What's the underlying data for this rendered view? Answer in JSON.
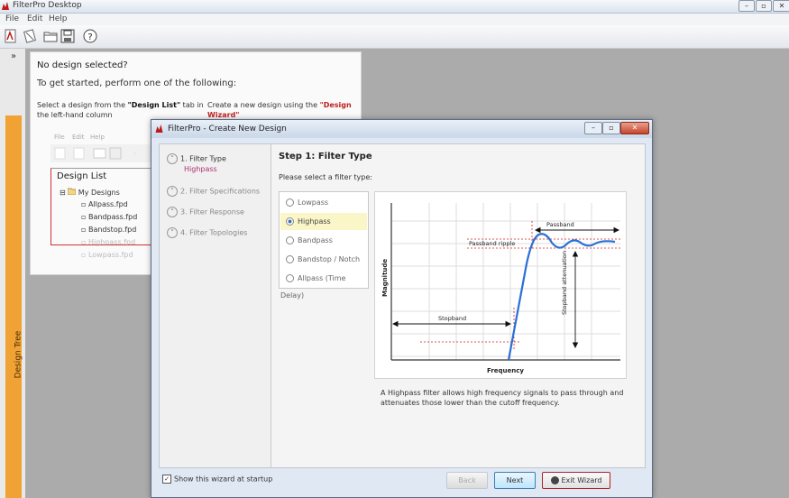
{
  "app": {
    "title": "FilterPro Desktop",
    "brand_color": "#c01818"
  },
  "menu": [
    "File",
    "Edit",
    "Help"
  ],
  "toolbar": {
    "icons": [
      "new-design-icon",
      "open-design-icon",
      "folder-icon",
      "save-icon",
      "help-icon"
    ]
  },
  "treebar": {
    "collapse": "»",
    "label": "Design Tree",
    "color": "#f0a234"
  },
  "welcome": {
    "heading": "No design selected?",
    "sub": "To get started, perform one of the following:",
    "col1_a": "Select a design from the ",
    "col1_b": "\"Design List\"",
    "col1_c": " tab in the left-hand column",
    "col2_a": "Create a new design using the ",
    "col2_b": "\"Design Wizard\"",
    "mini": {
      "menu": [
        "File",
        "Edit",
        "Help"
      ],
      "design_list_title": "Design List",
      "root": "My Designs",
      "files": [
        "Allpass.fpd",
        "Bandpass.fpd",
        "Bandstop.fpd",
        "Highpass.fpd",
        "Lowpass.fpd"
      ]
    }
  },
  "dialog": {
    "title": "FilterPro - Create New Design",
    "steps": [
      {
        "label": "1. Filter Type",
        "sub": "Highpass",
        "active": true
      },
      {
        "label": "2. Filter Specifications",
        "active": false
      },
      {
        "label": "3. Filter Response",
        "active": false
      },
      {
        "label": "4. Filter Topologies",
        "active": false
      }
    ],
    "step_heading": "Step 1: Filter Type",
    "prompt": "Please select a filter type:",
    "filter_types": [
      "Lowpass",
      "Highpass",
      "Bandpass",
      "Bandstop / Notch",
      "Allpass (Time Delay)"
    ],
    "selected_type": "Highpass",
    "description": "A Highpass filter allows high frequency signals to pass through and attenuates those lower than the cutoff frequency.",
    "show_wizard_label": "Show this wizard at startup",
    "show_wizard_checked": true,
    "buttons": {
      "back": "Back",
      "next": "Next",
      "exit": "Exit Wizard"
    }
  },
  "chart_data": {
    "type": "line",
    "title": "",
    "xlabel": "Frequency",
    "ylabel": "Magnitude",
    "annotations": [
      "Passband",
      "Passband ripple",
      "Stopband",
      "Stopband attenuation"
    ],
    "curve_color": "#2a6fd6",
    "marker_color": "#d42020"
  }
}
